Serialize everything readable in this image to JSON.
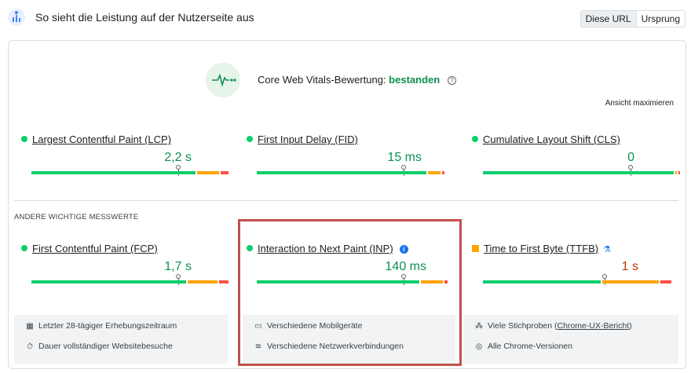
{
  "header": {
    "title": "So sieht die Leistung auf der Nutzerseite aus",
    "toggle": {
      "this_url": "Diese URL",
      "origin": "Ursprung"
    }
  },
  "cwv": {
    "label": "Core Web Vitals-Bewertung:",
    "status": "bestanden",
    "maximize": "Ansicht maximieren"
  },
  "metrics": {
    "lcp": {
      "title": "Largest Contentful Paint (LCP)",
      "value": "2,2 s",
      "marker": 0.74
    },
    "fid": {
      "title": "First Input Delay (FID)",
      "value": "15 ms",
      "marker": 0.74
    },
    "cls": {
      "title": "Cumulative Layout Shift (CLS)",
      "value": "0",
      "marker": 0.76
    }
  },
  "other_metrics": {
    "label": "ANDERE WICHTIGE MESSWERTE",
    "fcp": {
      "title": "First Contentful Paint (FCP)",
      "value": "1,7 s",
      "marker": 0.74
    },
    "inp": {
      "title": "Interaction to Next Paint (INP)",
      "value": "140 ms",
      "marker": 0.74
    },
    "ttfb": {
      "title": "Time to First Byte (TTFB)",
      "value": "1 s",
      "marker": 0.6
    }
  },
  "footer": {
    "period": "Letzter 28-tägiger Erhebungszeitraum",
    "duration": "Dauer vollständiger Websitebesuche",
    "devices": "Verschiedene Mobilgeräte",
    "network": "Verschiedene Netzwerkverbindungen",
    "samples_prefix": "Viele Stichproben (",
    "samples_link": "Chrome-UX-Bericht",
    "samples_suffix": ")",
    "versions": "Alle Chrome-Versionen"
  },
  "colors": {
    "good": "#0cce6b",
    "average": "#ffa400",
    "poor": "#ff4e42",
    "highlight": "#c0504d"
  }
}
